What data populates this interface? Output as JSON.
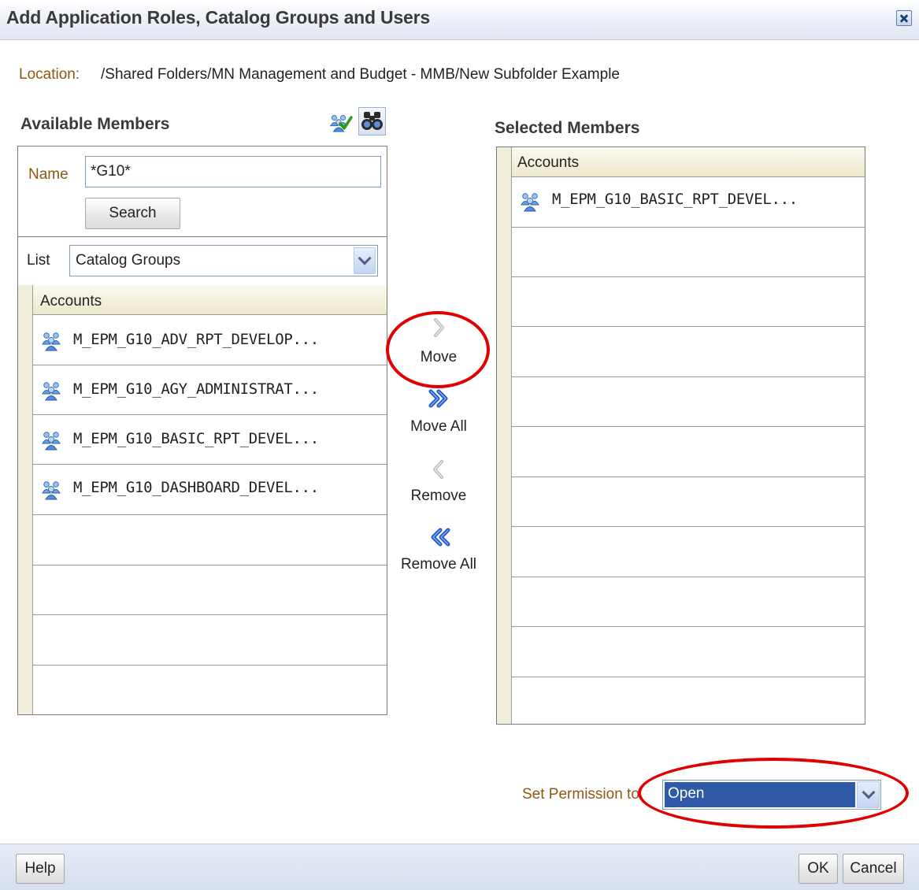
{
  "dialog": {
    "title": "Add Application Roles, Catalog Groups and Users"
  },
  "location": {
    "label": "Location:",
    "value": "/Shared Folders/MN Management and Budget - MMB/New Subfolder Example"
  },
  "available": {
    "title": "Available Members",
    "name_label": "Name",
    "name_value": "*G10*",
    "search_label": "Search",
    "list_label": "List",
    "list_value": "Catalog Groups",
    "column_header": "Accounts",
    "rows": [
      "M_EPM_G10_ADV_RPT_DEVELOP...",
      "M_EPM_G10_AGY_ADMINISTRAT...",
      "M_EPM_G10_BASIC_RPT_DEVEL...",
      "M_EPM_G10_DASHBOARD_DEVEL..."
    ]
  },
  "actions": {
    "move": "Move",
    "move_all": "Move All",
    "remove": "Remove",
    "remove_all": "Remove All"
  },
  "selected": {
    "title": "Selected Members",
    "column_header": "Accounts",
    "rows": [
      "M_EPM_G10_BASIC_RPT_DEVEL..."
    ]
  },
  "permission": {
    "label": "Set Permission to",
    "value": "Open"
  },
  "footer": {
    "help": "Help",
    "ok": "OK",
    "cancel": "Cancel"
  },
  "colors": {
    "label_brown": "#8a5a14",
    "highlight_red": "#e00000",
    "selection_blue": "#2e5aa8"
  },
  "icons": {
    "close": "close-icon",
    "group": "group-icon",
    "users_check": "users-check-icon",
    "search": "binoculars-icon"
  }
}
